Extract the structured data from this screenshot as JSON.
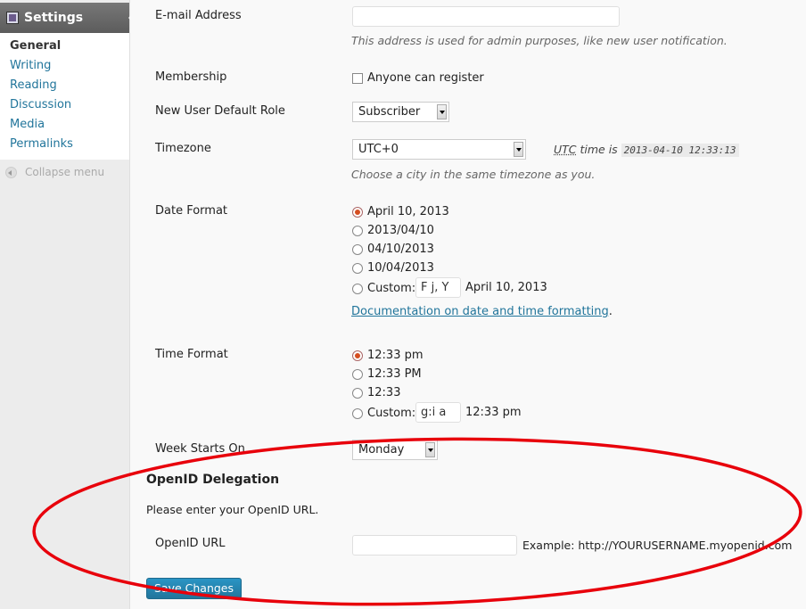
{
  "sidebar": {
    "title": "Settings",
    "items": [
      {
        "label": "General",
        "current": true
      },
      {
        "label": "Writing"
      },
      {
        "label": "Reading"
      },
      {
        "label": "Discussion"
      },
      {
        "label": "Media"
      },
      {
        "label": "Permalinks"
      }
    ],
    "collapse_label": "Collapse menu"
  },
  "form": {
    "email": {
      "label": "E-mail Address",
      "value": "",
      "description": "This address is used for admin purposes, like new user notification."
    },
    "membership": {
      "label": "Membership",
      "checkbox_label": "Anyone can register",
      "checked": false
    },
    "default_role": {
      "label": "New User Default Role",
      "selected": "Subscriber"
    },
    "timezone": {
      "label": "Timezone",
      "selected": "UTC+0",
      "utc_abbr": "UTC",
      "utc_text": " time is ",
      "utc_time": "2013-04-10 12:33:13",
      "description": "Choose a city in the same timezone as you."
    },
    "date_format": {
      "label": "Date Format",
      "options": [
        "April 10, 2013",
        "2013/04/10",
        "04/10/2013",
        "10/04/2013"
      ],
      "selected_index": 0,
      "custom_label": "Custom:",
      "custom_value": "F j, Y",
      "custom_preview": "April 10, 2013",
      "doc_link": "Documentation on date and time formatting",
      "doc_suffix": "."
    },
    "time_format": {
      "label": "Time Format",
      "options": [
        "12:33 pm",
        "12:33 PM",
        "12:33"
      ],
      "selected_index": 0,
      "custom_label": "Custom:",
      "custom_value": "g:i a",
      "custom_preview": "12:33 pm"
    },
    "week_starts": {
      "label": "Week Starts On",
      "selected": "Monday"
    },
    "openid": {
      "heading": "OpenID Delegation",
      "intro": "Please enter your OpenID URL.",
      "label": "OpenID URL",
      "value": "",
      "example": "Example: http://YOURUSERNAME.myopenid.com"
    },
    "save_label": "Save Changes"
  },
  "colors": {
    "link": "#21759b",
    "annotation": "#e8000b",
    "button": "#21759b"
  }
}
